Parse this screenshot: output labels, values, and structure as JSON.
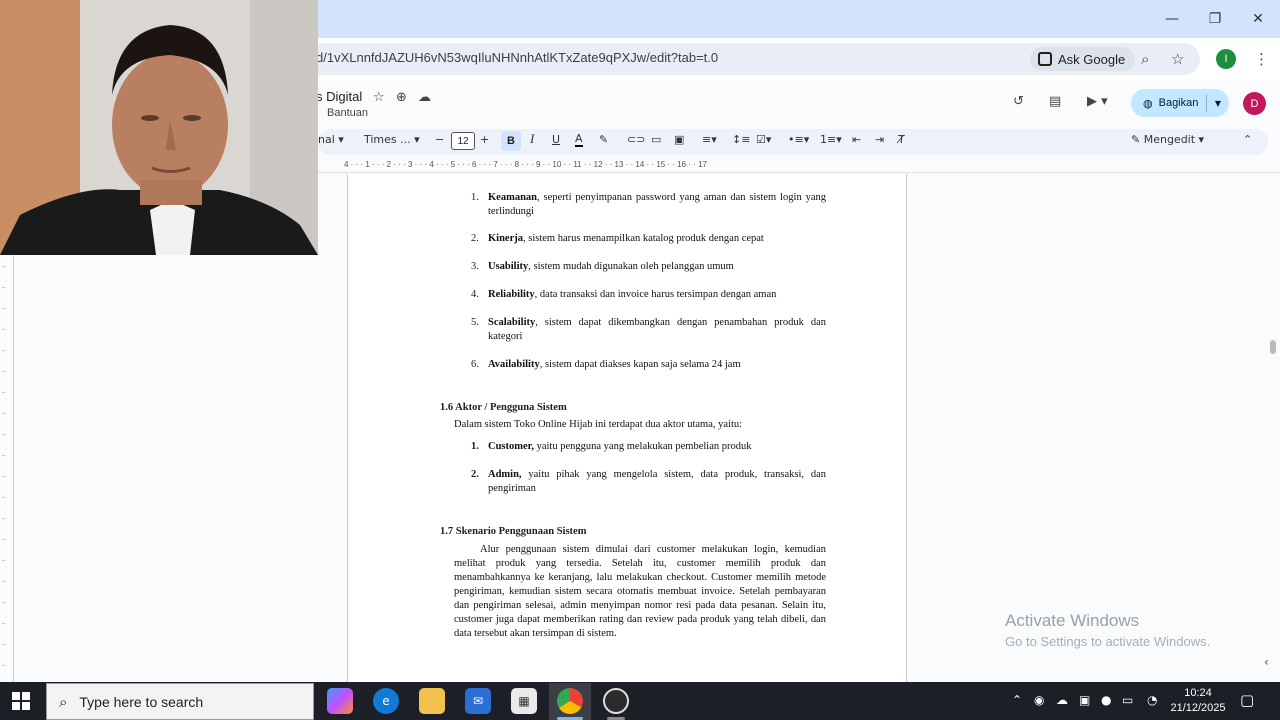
{
  "browser": {
    "url": "d/1vXLnnfdJAZUH6vN53wqIluNHNnhAtlKTxZate9qPXJw/edit?tab=t.0",
    "ask_google": "Ask Google",
    "profile_initial": "I",
    "window_controls": [
      "minimize-icon",
      "restore-icon",
      "close-icon"
    ]
  },
  "docs": {
    "title": "s Digital",
    "menu_item": "Bantuan",
    "share_label": "Bagikan",
    "avatar_initial": "D",
    "toolbar": {
      "style_fragment": "nal",
      "font": "Times ...",
      "font_size": "12",
      "bold": "B",
      "italic": "I",
      "underline": "U",
      "text_color": "A",
      "mode": "Mengedit"
    },
    "ruler_numbers": "4 · · · 1 · · · 2 · · · 3 · · · 4 · · · 5 · · · 6 · · · 7 · · · 8 · · · 9 · · 10 · · 11 · · 12 · · 13 · · 14 · · 15 · · 16 · · 17"
  },
  "document": {
    "requirements": [
      {
        "num": "1.",
        "term": "Keamanan",
        "text": ", seperti penyimpanan password yang aman dan sistem login yang terlindungi"
      },
      {
        "num": "2.",
        "term": "Kinerja",
        "text": ", sistem harus menampilkan katalog produk dengan cepat"
      },
      {
        "num": "3.",
        "term": "Usability",
        "text": ", sistem mudah digunakan oleh pelanggan umum"
      },
      {
        "num": "4.",
        "term": "Reliability",
        "text": ", data transaksi dan invoice harus tersimpan dengan aman"
      },
      {
        "num": "5.",
        "term": "Scalability",
        "text": ", sistem dapat dikembangkan dengan penambahan produk dan kategori"
      },
      {
        "num": "6.",
        "term": "Availability",
        "text": ", sistem dapat diakses kapan saja selama 24 jam"
      }
    ],
    "section_16": {
      "heading": "1.6 Aktor / Pengguna Sistem",
      "intro": "Dalam sistem Toko Online Hijab ini terdapat dua aktor utama, yaitu:",
      "actors": [
        {
          "num": "1.",
          "term": "Customer,",
          "text": " yaitu pengguna yang melakukan pembelian produk"
        },
        {
          "num": "2.",
          "term": "Admin,",
          "text": " yaitu pihak yang mengelola sistem, data produk, transaksi, dan pengiriman"
        }
      ]
    },
    "section_17": {
      "heading": "1.7  Skenario Penggunaan Sistem",
      "paragraph": "Alur penggunaan sistem dimulai dari customer melakukan login, kemudian melihat produk yang tersedia. Setelah itu, customer memilih produk dan menambahkannya ke keranjang, lalu melakukan checkout. Customer memilih metode pengiriman, kemudian sistem secara otomatis membuat invoice. Setelah pembayaran dan pengiriman selesai, admin menyimpan nomor resi pada data pesanan. Selain itu, customer juga dapat memberikan rating dan review pada produk yang telah dibeli, dan data tersebut akan tersimpan di sistem."
    }
  },
  "watermark": {
    "title": "Activate Windows",
    "subtitle": "Go to Settings to activate Windows."
  },
  "taskbar": {
    "search_placeholder": "Type here to search",
    "time": "10:24",
    "date": "21/12/2025"
  },
  "colors": {
    "titlebar": "#d3e3fd",
    "share_button": "#c2e7ff",
    "avatar": "#c2185b",
    "profile": "#1e8e3e",
    "taskbar": "#1c1f26"
  }
}
